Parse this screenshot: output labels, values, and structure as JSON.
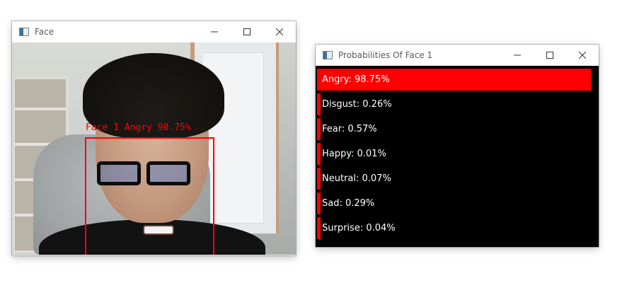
{
  "face_window": {
    "title": "Face",
    "detection_label": "Face 1 Angry 98.75%"
  },
  "prob_window": {
    "title": "Probabilities Of Face 1",
    "rows": [
      {
        "label": "Angry: 98.75%",
        "value": 0.9875
      },
      {
        "label": "Disgust: 0.26%",
        "value": 0.0026
      },
      {
        "label": "Fear: 0.57%",
        "value": 0.0057
      },
      {
        "label": "Happy: 0.01%",
        "value": 0.0001
      },
      {
        "label": "Neutral: 0.07%",
        "value": 0.0007
      },
      {
        "label": "Sad: 0.29%",
        "value": 0.0029
      },
      {
        "label": "Surprise: 0.04%",
        "value": 0.0004
      }
    ]
  },
  "icons": {
    "app": "opencv-window-icon",
    "minimize": "minimize-icon",
    "maximize": "maximize-icon",
    "close": "close-icon"
  },
  "colors": {
    "bar": "#ff0000",
    "detection": "#ff0000",
    "panel_bg": "#000000"
  }
}
